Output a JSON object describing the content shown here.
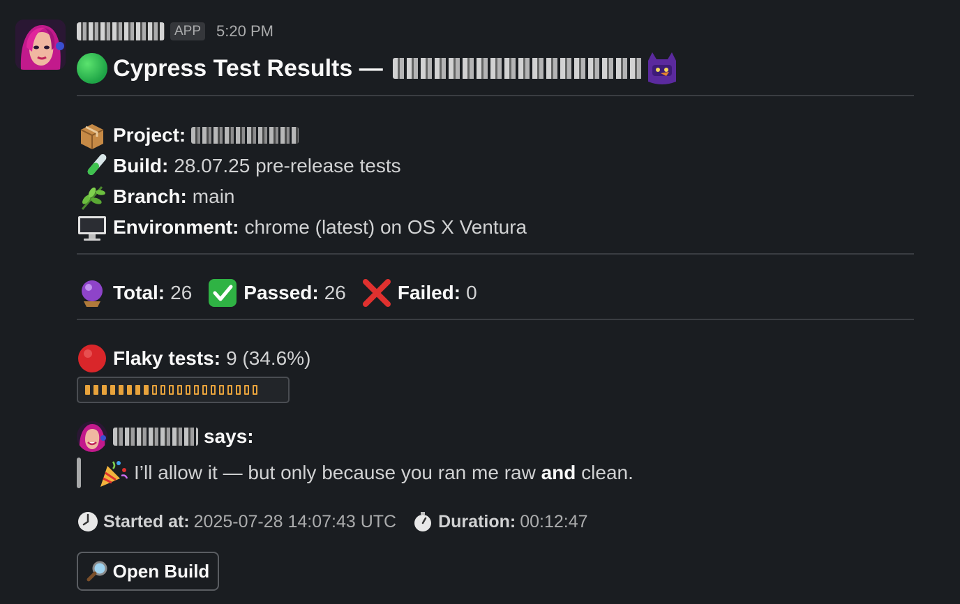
{
  "header": {
    "app_badge": "APP",
    "timestamp": "5:20 PM"
  },
  "title": {
    "status_icon": "green-circle-icon",
    "text": "Cypress Test Results —"
  },
  "info": [
    {
      "icon": "package-icon",
      "label": "Project:",
      "value": ""
    },
    {
      "icon": "test-tube-icon",
      "label": "Build:",
      "value": "28.07.25 pre-release tests"
    },
    {
      "icon": "herb-icon",
      "label": "Branch:",
      "value": "main"
    },
    {
      "icon": "desktop-computer-icon",
      "label": "Environment:",
      "value": "chrome (latest) on OS X Ventura"
    }
  ],
  "stats": {
    "total": {
      "icon": "crystal-ball-icon",
      "label": "Total:",
      "value": "26"
    },
    "passed": {
      "icon": "check-mark-button-icon",
      "label": "Passed:",
      "value": "26"
    },
    "failed": {
      "icon": "cross-mark-icon",
      "label": "Failed:",
      "value": "0"
    }
  },
  "flaky": {
    "icon": "red-circle-icon",
    "label": "Flaky tests:",
    "value": "9 (34.6%)",
    "bar_fraction": 0.346,
    "bar_segments_total": 21,
    "bar_segments_filled": 8
  },
  "says": {
    "label": "says:",
    "quote_icon": "party-popper-icon",
    "quote_before": "I’ll allow it — but only because you ran me raw ",
    "quote_bold": "and",
    "quote_after": " clean."
  },
  "footer": {
    "started": {
      "icon": "clock-icon",
      "label": "Started at:",
      "value": "2025-07-28 14:07:43 UTC"
    },
    "duration": {
      "icon": "stopwatch-icon",
      "label": "Duration:",
      "value": "00:12:47"
    }
  },
  "button": {
    "icon": "magnifying-glass-icon",
    "label": "Open Build"
  },
  "colors": {
    "background": "#1a1d21",
    "accent_bar": "#e8a33c",
    "passed_green": "#2fb344",
    "failed_red": "#e0312f"
  }
}
